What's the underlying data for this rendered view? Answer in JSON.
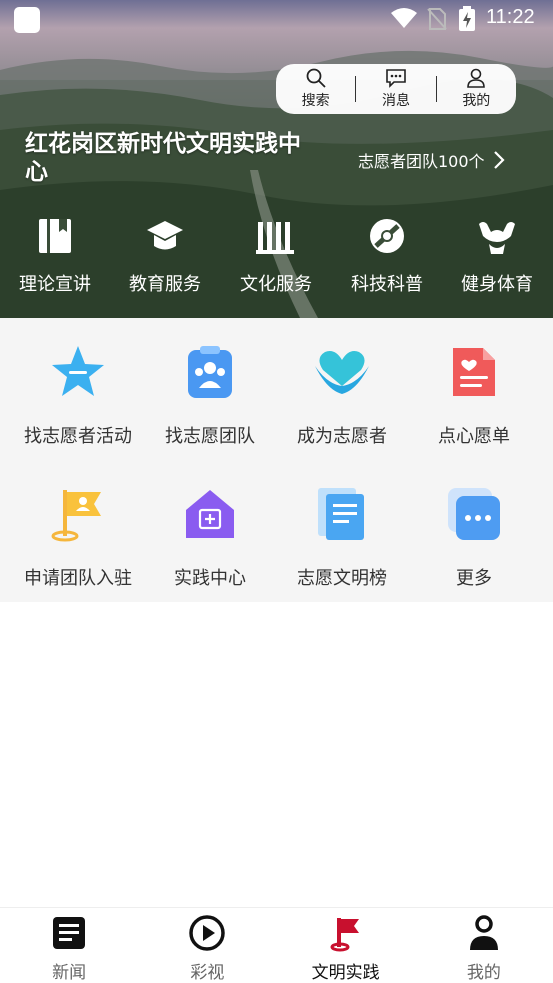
{
  "status_bar": {
    "time": "11:22"
  },
  "top_bar": {
    "search_label": "搜索",
    "messages_label": "消息",
    "mine_label": "我的"
  },
  "hero": {
    "title": "红花岗区新时代文明实践中心",
    "volunteer_teams_link": "志愿者团队100个"
  },
  "categories": [
    {
      "label": "理论宣讲",
      "icon": "book-icon"
    },
    {
      "label": "教育服务",
      "icon": "graduation-cap-icon"
    },
    {
      "label": "文化服务",
      "icon": "culture-pillars-icon"
    },
    {
      "label": "科技科普",
      "icon": "satellite-icon"
    },
    {
      "label": "健身体育",
      "icon": "muscle-icon"
    }
  ],
  "services": [
    {
      "label": "找志愿者活动",
      "icon": "star-icon"
    },
    {
      "label": "找志愿团队",
      "icon": "team-clipboard-icon"
    },
    {
      "label": "成为志愿者",
      "icon": "heart-hands-icon"
    },
    {
      "label": "点心愿单",
      "icon": "wish-list-icon"
    },
    {
      "label": "申请团队入驻",
      "icon": "flag-icon"
    },
    {
      "label": "实践中心",
      "icon": "house-icon"
    },
    {
      "label": "志愿文明榜",
      "icon": "document-icon"
    },
    {
      "label": "更多",
      "icon": "more-icon"
    }
  ],
  "bottom_nav": [
    {
      "label": "新闻",
      "icon": "news-icon"
    },
    {
      "label": "彩视",
      "icon": "play-icon"
    },
    {
      "label": "文明实践",
      "icon": "red-flag-icon",
      "active": true
    },
    {
      "label": "我的",
      "icon": "user-icon"
    }
  ],
  "colors": {
    "active_tab": "#c8102e",
    "grid_background": "#f5f5f5"
  }
}
